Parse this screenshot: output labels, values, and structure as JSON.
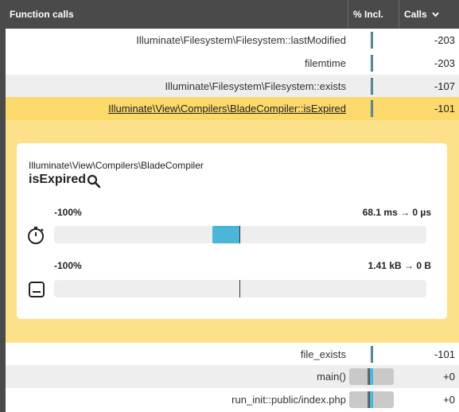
{
  "header": {
    "col_function": "Function calls",
    "col_incl": "% Incl.",
    "col_calls": "Calls",
    "sort_icon": "chevron-down-icon"
  },
  "rows_top": [
    {
      "name": "Illuminate\\Filesystem\\Filesystem::lastModified",
      "calls": "-203"
    },
    {
      "name": "filemtime",
      "calls": "-203"
    },
    {
      "name": "Illuminate\\Filesystem\\Filesystem::exists",
      "calls": "-107"
    },
    {
      "name": "Illuminate\\View\\Compilers\\BladeCompiler::isExpired",
      "calls": "-101"
    }
  ],
  "detail": {
    "namespace": "Illuminate\\View\\Compilers\\BladeCompiler",
    "function": "isExpired",
    "metrics": [
      {
        "icon": "stopwatch-icon",
        "percent": "-100%",
        "value": "68.1 ms → 0 µs"
      },
      {
        "icon": "memory-icon",
        "percent": "-100%",
        "value": "1.41 kB → 0 B"
      }
    ]
  },
  "rows_bottom": [
    {
      "name": "file_exists",
      "calls": "-101"
    },
    {
      "name": "main()",
      "calls": "+0"
    },
    {
      "name": "run_init::public/index.php",
      "calls": "+0"
    }
  ],
  "colors": {
    "header_bg": "#4a4a4a",
    "selected_row": "#fbd96a",
    "detail_bg": "#fde08a",
    "accent_blue": "#4ab6d8"
  }
}
